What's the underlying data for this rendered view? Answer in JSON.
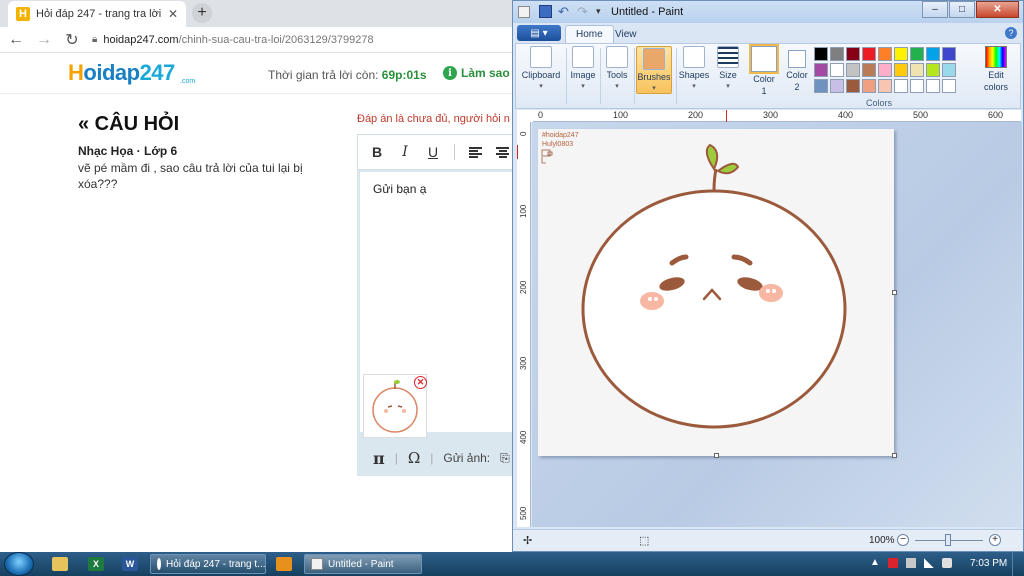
{
  "browser": {
    "tab_title": "Hỏi đáp 247 - trang tra lời",
    "tab_close": "✕",
    "new_tab": "+",
    "url_domain": "hoidap247.com",
    "url_path": "/chinh-sua-cau-tra-loi/2063129/3799278"
  },
  "site": {
    "logo_h": "H",
    "logo_text": "oidap",
    "logo_num": "247",
    "logo_com": ".com",
    "timer_label": "Thời gian trả lời còn:",
    "timer_value": "69p:01s",
    "help_link": "Làm sao đ"
  },
  "question": {
    "heading": "« CÂU HỎI",
    "meta": "Nhạc Họa · Lớp 6",
    "text": "vẽ pé mầm đi , sao câu trả lời của tui lại bị xóa???"
  },
  "answer": {
    "notice": "Đáp án là chưa đủ, người hỏi n",
    "bold": "B",
    "italic": "I",
    "underline": "U",
    "body_text": "Gửi bạn ạ",
    "remove": "✕",
    "pi": "π",
    "omega": "Ω",
    "sep": "|",
    "send_image": "Gửi ảnh:",
    "clip": "⎘"
  },
  "paint": {
    "title": "Untitled - Paint",
    "win_minimize": "‒",
    "win_maximize": "□",
    "win_close": "✕",
    "file_menu": "▤ ▾",
    "tab_home": "Home",
    "tab_view": "View",
    "help": "?",
    "groups": {
      "clipboard": "Clipboard",
      "image": "Image",
      "tools": "Tools",
      "brushes": "Brushes",
      "shapes": "Shapes",
      "size": "Size",
      "color1_a": "Color",
      "color1_b": "1",
      "color2_a": "Color",
      "color2_b": "2",
      "edit_colors_a": "Edit",
      "edit_colors_b": "colors",
      "colors": "Colors",
      "caret": "▾"
    },
    "palette": [
      "#000000",
      "#7f7f7f",
      "#880015",
      "#ed1c24",
      "#ff7f27",
      "#fff200",
      "#22b14c",
      "#00a2e8",
      "#3f48cc",
      "#a349a4",
      "#ffffff",
      "#c3c3c3",
      "#b97a57",
      "#ffaec9",
      "#ffc90e",
      "#efe4b0",
      "#b5e61d",
      "#99d9ea",
      "#7092be",
      "#c8bfe7",
      "#9c5a3c",
      "#f0a080",
      "#f7c5b0",
      "#ffffff",
      "#ffffff",
      "#ffffff",
      "#ffffff",
      "#ffffff",
      "#ffffff",
      "#ffffff"
    ],
    "ruler_h": [
      "0",
      "100",
      "200",
      "300",
      "400",
      "500",
      "600"
    ],
    "ruler_v": [
      "0",
      "100",
      "200",
      "300",
      "400",
      "500"
    ],
    "watermark_1": "#hoidap247",
    "watermark_2": "Hulyl0803",
    "zoom": "100%",
    "zoom_minus": "−",
    "zoom_plus": "+",
    "status_move": "✢",
    "status_select": "⬚"
  },
  "taskbar": {
    "task_chrome": "Hỏi đáp 247 - trang t...",
    "task_paint": "Untitled - Paint",
    "excel_label": "X",
    "word_label": "W",
    "tray_up": "▲",
    "clock": "7:03 PM"
  },
  "colors": {
    "drawing_brown": "#9c5a3c",
    "sprout_green": "#9ccc3c",
    "blush_pink": "#f7b7a3"
  }
}
